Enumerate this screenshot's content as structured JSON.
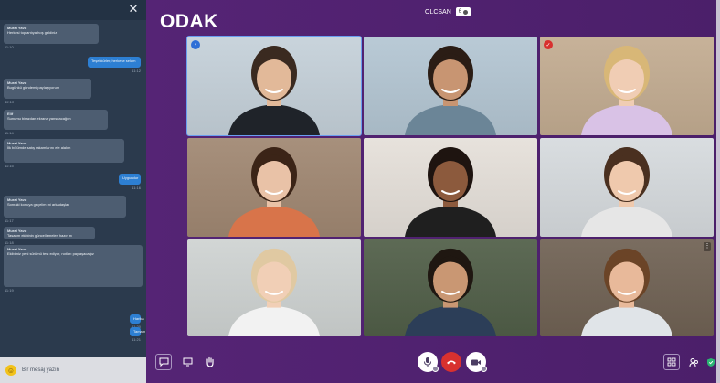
{
  "app": {
    "brand": "ODAK",
    "host_name": "OLCSAN",
    "host_badge": "6"
  },
  "chat": {
    "messages": [
      {
        "dir": "in",
        "sender": "Murat Yavu",
        "body": "Herkesi toplantıya hoş geldiniz",
        "time": "11:10"
      },
      {
        "dir": "out",
        "sender": "",
        "body": "Teşekkürler, herkese selam",
        "time": "11:12"
      },
      {
        "dir": "in",
        "sender": "Murat Yavu",
        "body": "Bugünkü gündemi paylaşıyorum",
        "time": "11:13"
      },
      {
        "dir": "in",
        "sender": "Elif",
        "body": "Sunumu birazdan ekrana yansıtacağım",
        "time": "11:14"
      },
      {
        "dir": "in",
        "sender": "Murat Yavu",
        "body": "İlk bölümde satış rakamlarını ele alalım",
        "time": "11:15"
      },
      {
        "dir": "out",
        "sender": "",
        "body": "Uygundur",
        "time": "11:16"
      },
      {
        "dir": "in",
        "sender": "Murat Yavu",
        "body": "Sonraki konuya geçelim mi arkadaşlar",
        "time": "11:17"
      },
      {
        "dir": "in",
        "sender": "Murat Yavu",
        "body": "Tasarım ekibinin güncellemeleri hazır mı",
        "time": "11:18"
      },
      {
        "dir": "in",
        "sender": "Murat Yavu",
        "body": "Ekibimiz yeni sürümü test ediyor, notları paylaşacağız",
        "time": "11:19"
      },
      {
        "dir": "out",
        "sender": "",
        "body": "Harika",
        "time": "11:20"
      },
      {
        "dir": "out",
        "sender": "",
        "body": "Tamam",
        "time": "11:21"
      }
    ],
    "input_placeholder": "Bir mesaj yazın"
  },
  "colors": {
    "stage": "#4f2170",
    "active_outline": "#6a9ef0",
    "hangup": "#d8312f",
    "accent_green": "#2bb673",
    "badge_blue": "#2f6fd6",
    "badge_red": "#d8312f"
  },
  "participants": [
    {
      "name": "tile-1",
      "bg": "#c9d4dc",
      "skin": "#e2b999",
      "hair": "#3a2a20",
      "shirt": "#1f2329",
      "badge": "mic-icon"
    },
    {
      "name": "tile-2",
      "bg": "#b9cad6",
      "skin": "#c89572",
      "hair": "#2b1d15",
      "shirt": "#6b8597"
    },
    {
      "name": "tile-3",
      "bg": "#c7b299",
      "skin": "#f0cdb4",
      "hair": "#d8b777",
      "shirt": "#d9c2e6",
      "badge": "check-icon"
    },
    {
      "name": "tile-4",
      "bg": "#a7907c",
      "skin": "#e9c2a7",
      "hair": "#3b2417",
      "shirt": "#d8744a"
    },
    {
      "name": "tile-5",
      "bg": "#e7e2dc",
      "skin": "#8c5a3d",
      "hair": "#1e1410",
      "shirt": "#1f1f1f"
    },
    {
      "name": "tile-6",
      "bg": "#d9dde0",
      "skin": "#efc9ad",
      "hair": "#4a3020",
      "shirt": "#e6e6e6"
    },
    {
      "name": "tile-7",
      "bg": "#d2d6d5",
      "skin": "#f1cfb6",
      "hair": "#e0c9a2",
      "shirt": "#f2f2f2"
    },
    {
      "name": "tile-8",
      "bg": "#5d6a55",
      "skin": "#c99773",
      "hair": "#1f1711",
      "shirt": "#2c3e58"
    },
    {
      "name": "tile-9",
      "bg": "#7a6d60",
      "skin": "#e8b99a",
      "hair": "#6b4427",
      "shirt": "#e0e4e8",
      "more": true
    }
  ]
}
